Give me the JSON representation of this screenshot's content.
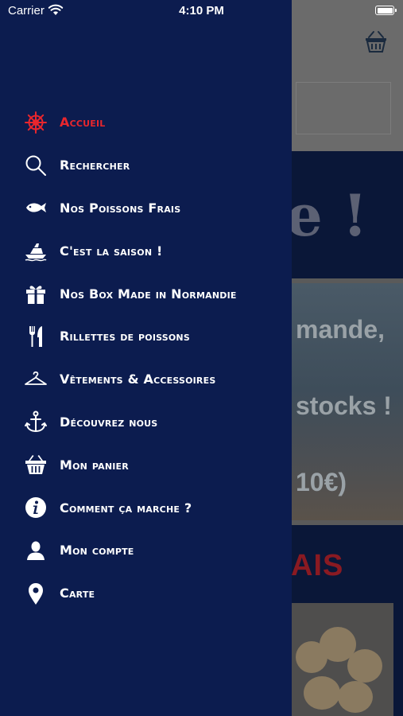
{
  "status_bar": {
    "carrier": "Carrier",
    "time": "4:10 PM"
  },
  "background": {
    "banner_text": "e !",
    "photo_lines": [
      "mande,",
      "stocks !",
      "10€)"
    ],
    "section_title": "AIS"
  },
  "menu": {
    "items": [
      {
        "label": "Accueil",
        "icon": "ship-wheel-icon",
        "active": true
      },
      {
        "label": "Rechercher",
        "icon": "search-icon"
      },
      {
        "label": "Nos Poissons Frais",
        "icon": "fish-icon"
      },
      {
        "label": "C'est la saison !",
        "icon": "boat-icon"
      },
      {
        "label": "Nos Box Made in Normandie",
        "icon": "gift-icon"
      },
      {
        "label": "Rillettes de poissons",
        "icon": "fork-knife-icon"
      },
      {
        "label": "Vêtements & Accessoires",
        "icon": "hanger-icon"
      },
      {
        "label": "Découvrez nous",
        "icon": "anchor-icon"
      },
      {
        "label": "Mon panier",
        "icon": "basket-icon"
      },
      {
        "label": "Comment ça marche ?",
        "icon": "info-icon"
      },
      {
        "label": "Mon compte",
        "icon": "user-icon"
      },
      {
        "label": "Carte",
        "icon": "map-pin-icon"
      }
    ]
  },
  "colors": {
    "drawer": "#0c1c4f",
    "accent": "#e8262d",
    "text": "#ffffff"
  }
}
